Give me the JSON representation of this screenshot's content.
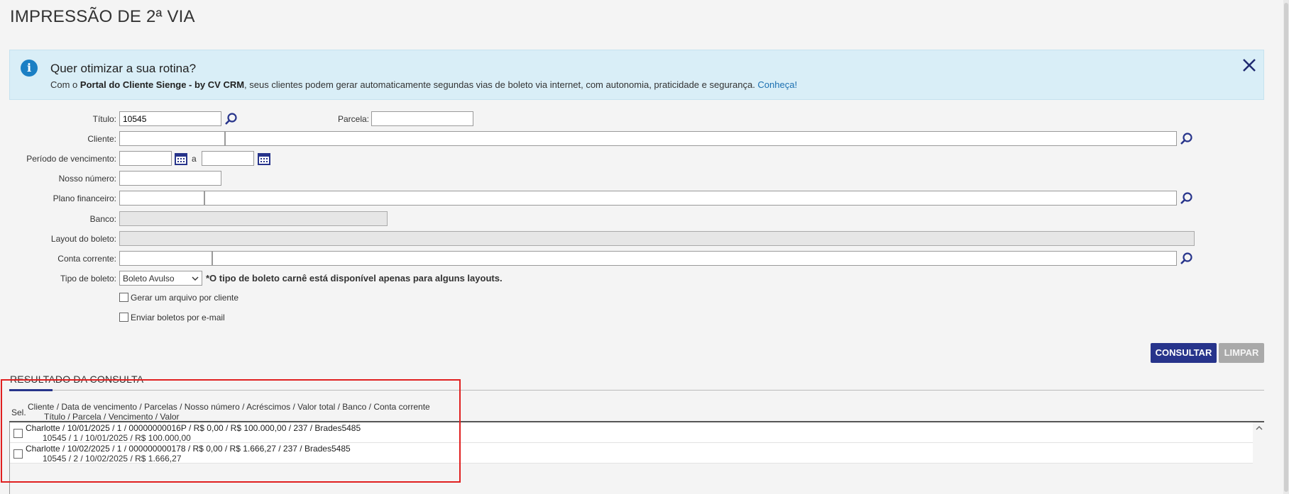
{
  "page": {
    "title": "IMPRESSÃO DE 2ª VIA"
  },
  "banner": {
    "title": "Quer otimizar a sua rotina?",
    "text_prefix": "Com o ",
    "text_bold": "Portal do Cliente Sienge - by CV CRM",
    "text_body": ", seus clientes podem gerar automaticamente segundas vias de boleto via internet, com autonomia, praticidade e segurança. ",
    "link": "Conheça!",
    "info_icon": "i"
  },
  "form": {
    "titulo": {
      "label": "Título:",
      "value": "10545"
    },
    "parcela": {
      "label": "Parcela:",
      "value": ""
    },
    "cliente": {
      "label": "Cliente:"
    },
    "periodo": {
      "label": "Período de vencimento:",
      "separator": "a"
    },
    "nosso_numero": {
      "label": "Nosso número:"
    },
    "plano": {
      "label": "Plano financeiro:"
    },
    "banco": {
      "label": "Banco:"
    },
    "layout": {
      "label": "Layout do boleto:"
    },
    "conta": {
      "label": "Conta corrente:"
    },
    "tipo": {
      "label": "Tipo de boleto:",
      "selected": "Boleto Avulso",
      "note": "*O tipo de boleto carnê está disponível apenas para alguns layouts."
    },
    "gerar_arquivo": {
      "label": "Gerar um arquivo por cliente",
      "checked": false
    },
    "enviar_email": {
      "label": "Enviar boletos por e-mail",
      "checked": false
    }
  },
  "buttons": {
    "consultar": "CONSULTAR",
    "limpar": "LIMPAR"
  },
  "results": {
    "title": "RESULTADO DA CONSULTA",
    "sel_header": "Sel.",
    "header_line1": "Cliente / Data de vencimento / Parcelas / Nosso número / Acréscimos / Valor total / Banco / Conta corrente",
    "header_line2": "Título / Parcela / Vencimento / Valor",
    "rows": [
      {
        "line1": "Charlotte / 10/01/2025 / 1 / 00000000016P / R$ 0,00 / R$ 100.000,00 / 237 / Brades5485",
        "line2": "10545 / 1 / 10/01/2025 / R$ 100.000,00"
      },
      {
        "line1": "Charlotte / 10/02/2025 / 1 / 000000000178 / R$ 0,00 / R$ 1.666,27 / 237 / Brades5485",
        "line2": "10545 / 2 / 10/02/2025 / R$ 1.666,27"
      }
    ]
  },
  "colors": {
    "primary": "#27348b",
    "banner_bg": "#d9eef7",
    "highlight": "#e02020"
  }
}
